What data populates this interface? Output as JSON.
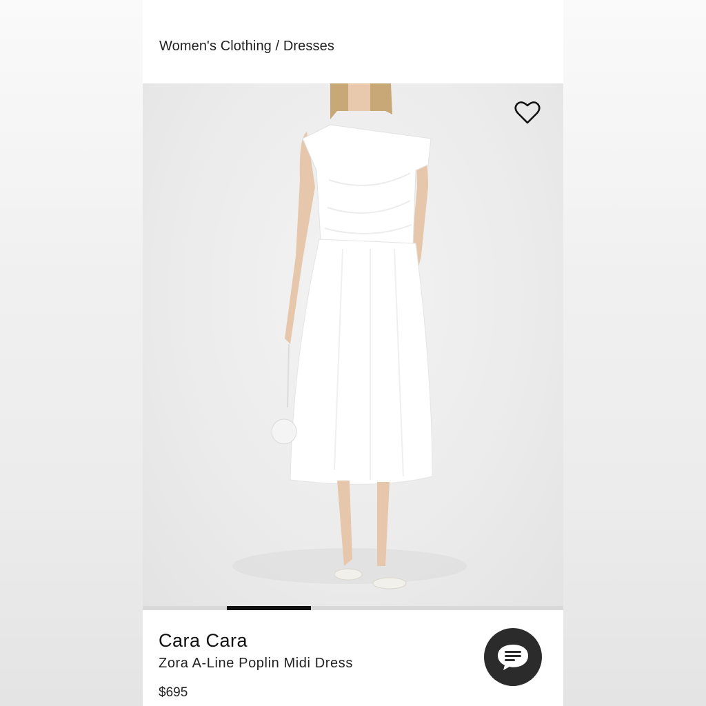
{
  "breadcrumb": "Women's Clothing / Dresses",
  "product": {
    "brand": "Cara Cara",
    "name": "Zora A-Line Poplin Midi Dress",
    "price": "$695"
  },
  "gallery": {
    "image_index": 2,
    "image_count": 5,
    "favorite_icon": "heart-outline-icon"
  },
  "chat": {
    "icon": "chat-bubble-icon"
  },
  "colors": {
    "progress_active": "#111111",
    "progress_track": "#d9d9d9",
    "chat_button": "#2b2b2b"
  }
}
